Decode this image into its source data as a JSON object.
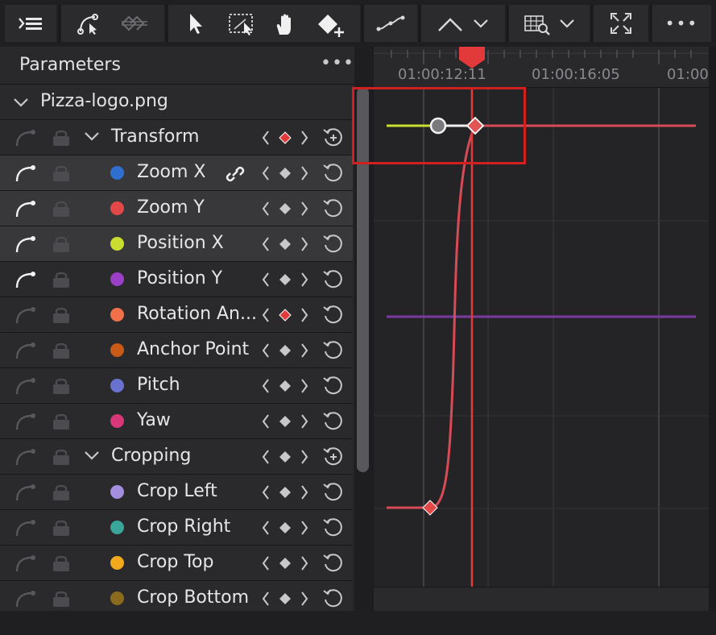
{
  "toolbar": {
    "icons": [
      "list-toggle-icon",
      "curve-select-icon",
      "reset-keyframes-icon",
      "pointer-icon",
      "marquee-select-icon",
      "hand-icon",
      "add-keyframe-icon",
      "bezier-icon",
      "interpolation-icon",
      "chevron-down-icon",
      "graph-zoom-icon",
      "chevron-down-icon",
      "fit-icon",
      "more-icon"
    ],
    "more_label": "•••"
  },
  "panel": {
    "title": "Parameters",
    "more_label": "•••",
    "clip_name": "Pizza-logo.png"
  },
  "rows": [
    {
      "label": "Transform",
      "group": true,
      "keyframe": "red",
      "highlight": false,
      "curve_on": false
    },
    {
      "label": "Zoom X",
      "color": "#2f6fd0",
      "keyframe": "gray",
      "highlight": true,
      "curve_on": true,
      "linked": true
    },
    {
      "label": "Zoom Y",
      "color": "#e24848",
      "keyframe": "gray",
      "highlight": true,
      "curve_on": true
    },
    {
      "label": "Position X",
      "color": "#c9dc30",
      "keyframe": "gray",
      "highlight": true,
      "curve_on": true
    },
    {
      "label": "Position Y",
      "color": "#9a3fc6",
      "keyframe": "gray",
      "highlight": false,
      "curve_on": true
    },
    {
      "label": "Rotation An...",
      "color": "#f0704a",
      "keyframe": "red",
      "highlight": false,
      "curve_on": false
    },
    {
      "label": "Anchor Point",
      "color": "#c75a17",
      "keyframe": "gray",
      "highlight": false,
      "curve_on": false
    },
    {
      "label": "Pitch",
      "color": "#6a72d0",
      "keyframe": "gray",
      "highlight": false,
      "curve_on": false
    },
    {
      "label": "Yaw",
      "color": "#d83878",
      "keyframe": "gray",
      "highlight": false,
      "curve_on": false
    },
    {
      "label": "Cropping",
      "group": true,
      "keyframe": "gray",
      "highlight": false,
      "curve_on": false
    },
    {
      "label": "Crop Left",
      "color": "#a48ee0",
      "keyframe": "gray",
      "highlight": false,
      "curve_on": false
    },
    {
      "label": "Crop Right",
      "color": "#3aa59a",
      "keyframe": "gray",
      "highlight": false,
      "curve_on": false
    },
    {
      "label": "Crop Top",
      "color": "#f2a91e",
      "keyframe": "gray",
      "highlight": false,
      "curve_on": false
    },
    {
      "label": "Crop Bottom",
      "color": "#8a6a1c",
      "keyframe": "gray",
      "highlight": false,
      "curve_on": false
    }
  ],
  "timeline": {
    "timecodes": [
      "01:00:12:11",
      "01:00:16:05",
      "01:00"
    ],
    "playhead_color": "#e23a3a"
  },
  "colors": {
    "accent_red": "#e23a3a",
    "selection_red": "#d22020"
  }
}
